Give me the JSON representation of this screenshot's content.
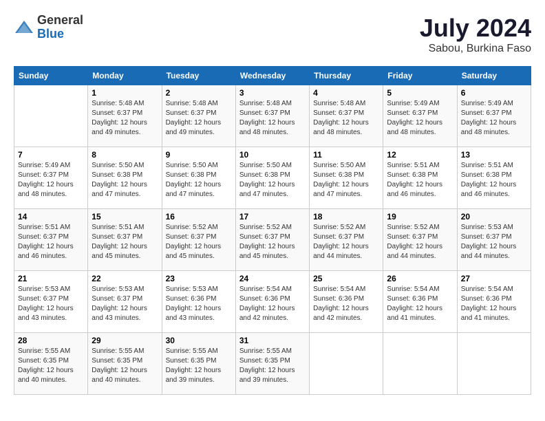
{
  "header": {
    "logo": {
      "general": "General",
      "blue": "Blue"
    },
    "title": "July 2024",
    "subtitle": "Sabou, Burkina Faso"
  },
  "calendar": {
    "weekdays": [
      "Sunday",
      "Monday",
      "Tuesday",
      "Wednesday",
      "Thursday",
      "Friday",
      "Saturday"
    ],
    "weeks": [
      [
        {
          "day": "",
          "info": ""
        },
        {
          "day": "1",
          "info": "Sunrise: 5:48 AM\nSunset: 6:37 PM\nDaylight: 12 hours\nand 49 minutes."
        },
        {
          "day": "2",
          "info": "Sunrise: 5:48 AM\nSunset: 6:37 PM\nDaylight: 12 hours\nand 49 minutes."
        },
        {
          "day": "3",
          "info": "Sunrise: 5:48 AM\nSunset: 6:37 PM\nDaylight: 12 hours\nand 48 minutes."
        },
        {
          "day": "4",
          "info": "Sunrise: 5:48 AM\nSunset: 6:37 PM\nDaylight: 12 hours\nand 48 minutes."
        },
        {
          "day": "5",
          "info": "Sunrise: 5:49 AM\nSunset: 6:37 PM\nDaylight: 12 hours\nand 48 minutes."
        },
        {
          "day": "6",
          "info": "Sunrise: 5:49 AM\nSunset: 6:37 PM\nDaylight: 12 hours\nand 48 minutes."
        }
      ],
      [
        {
          "day": "7",
          "info": "Sunrise: 5:49 AM\nSunset: 6:37 PM\nDaylight: 12 hours\nand 48 minutes."
        },
        {
          "day": "8",
          "info": "Sunrise: 5:50 AM\nSunset: 6:38 PM\nDaylight: 12 hours\nand 47 minutes."
        },
        {
          "day": "9",
          "info": "Sunrise: 5:50 AM\nSunset: 6:38 PM\nDaylight: 12 hours\nand 47 minutes."
        },
        {
          "day": "10",
          "info": "Sunrise: 5:50 AM\nSunset: 6:38 PM\nDaylight: 12 hours\nand 47 minutes."
        },
        {
          "day": "11",
          "info": "Sunrise: 5:50 AM\nSunset: 6:38 PM\nDaylight: 12 hours\nand 47 minutes."
        },
        {
          "day": "12",
          "info": "Sunrise: 5:51 AM\nSunset: 6:38 PM\nDaylight: 12 hours\nand 46 minutes."
        },
        {
          "day": "13",
          "info": "Sunrise: 5:51 AM\nSunset: 6:38 PM\nDaylight: 12 hours\nand 46 minutes."
        }
      ],
      [
        {
          "day": "14",
          "info": "Sunrise: 5:51 AM\nSunset: 6:37 PM\nDaylight: 12 hours\nand 46 minutes."
        },
        {
          "day": "15",
          "info": "Sunrise: 5:51 AM\nSunset: 6:37 PM\nDaylight: 12 hours\nand 45 minutes."
        },
        {
          "day": "16",
          "info": "Sunrise: 5:52 AM\nSunset: 6:37 PM\nDaylight: 12 hours\nand 45 minutes."
        },
        {
          "day": "17",
          "info": "Sunrise: 5:52 AM\nSunset: 6:37 PM\nDaylight: 12 hours\nand 45 minutes."
        },
        {
          "day": "18",
          "info": "Sunrise: 5:52 AM\nSunset: 6:37 PM\nDaylight: 12 hours\nand 44 minutes."
        },
        {
          "day": "19",
          "info": "Sunrise: 5:52 AM\nSunset: 6:37 PM\nDaylight: 12 hours\nand 44 minutes."
        },
        {
          "day": "20",
          "info": "Sunrise: 5:53 AM\nSunset: 6:37 PM\nDaylight: 12 hours\nand 44 minutes."
        }
      ],
      [
        {
          "day": "21",
          "info": "Sunrise: 5:53 AM\nSunset: 6:37 PM\nDaylight: 12 hours\nand 43 minutes."
        },
        {
          "day": "22",
          "info": "Sunrise: 5:53 AM\nSunset: 6:37 PM\nDaylight: 12 hours\nand 43 minutes."
        },
        {
          "day": "23",
          "info": "Sunrise: 5:53 AM\nSunset: 6:36 PM\nDaylight: 12 hours\nand 43 minutes."
        },
        {
          "day": "24",
          "info": "Sunrise: 5:54 AM\nSunset: 6:36 PM\nDaylight: 12 hours\nand 42 minutes."
        },
        {
          "day": "25",
          "info": "Sunrise: 5:54 AM\nSunset: 6:36 PM\nDaylight: 12 hours\nand 42 minutes."
        },
        {
          "day": "26",
          "info": "Sunrise: 5:54 AM\nSunset: 6:36 PM\nDaylight: 12 hours\nand 41 minutes."
        },
        {
          "day": "27",
          "info": "Sunrise: 5:54 AM\nSunset: 6:36 PM\nDaylight: 12 hours\nand 41 minutes."
        }
      ],
      [
        {
          "day": "28",
          "info": "Sunrise: 5:55 AM\nSunset: 6:35 PM\nDaylight: 12 hours\nand 40 minutes."
        },
        {
          "day": "29",
          "info": "Sunrise: 5:55 AM\nSunset: 6:35 PM\nDaylight: 12 hours\nand 40 minutes."
        },
        {
          "day": "30",
          "info": "Sunrise: 5:55 AM\nSunset: 6:35 PM\nDaylight: 12 hours\nand 39 minutes."
        },
        {
          "day": "31",
          "info": "Sunrise: 5:55 AM\nSunset: 6:35 PM\nDaylight: 12 hours\nand 39 minutes."
        },
        {
          "day": "",
          "info": ""
        },
        {
          "day": "",
          "info": ""
        },
        {
          "day": "",
          "info": ""
        }
      ]
    ]
  }
}
